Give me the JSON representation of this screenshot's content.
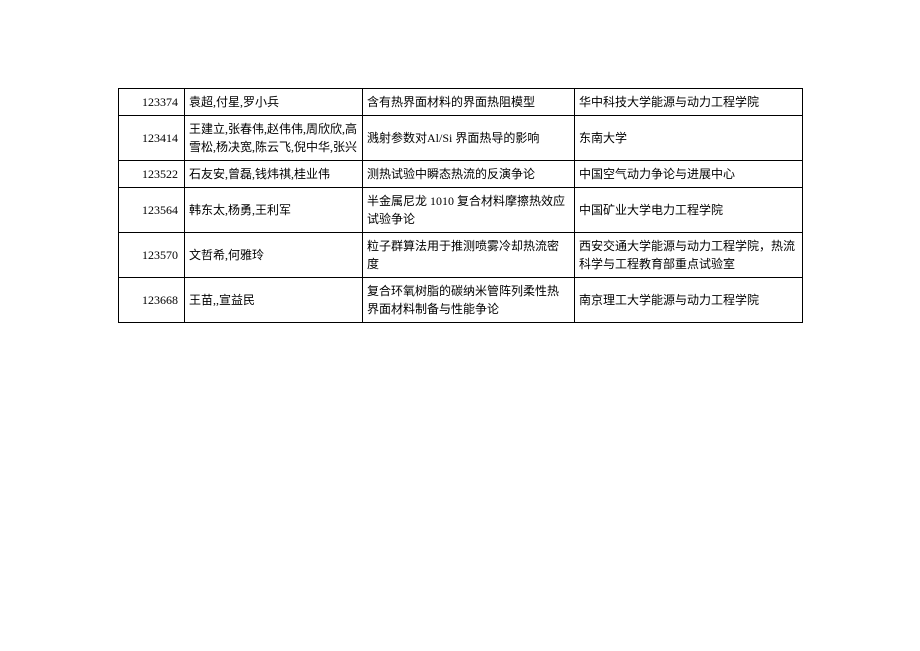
{
  "rows": [
    {
      "id": "123374",
      "authors": "袁超,付星,罗小兵",
      "title": "含有热界面材料的界面热阻模型",
      "affiliation": "华中科技大学能源与动力工程学院"
    },
    {
      "id": "123414",
      "authors": "王建立,张春伟,赵伟伟,周欣欣,高雪松,杨决宽,陈云飞,倪中华,张兴",
      "title": "溅射参数对Al/Si 界面热导的影响",
      "affiliation": "东南大学"
    },
    {
      "id": "123522",
      "authors": "石友安,曾磊,钱炜祺,桂业伟",
      "title": "测热试验中瞬态热流的反演争论",
      "affiliation": "中国空气动力争论与进展中心"
    },
    {
      "id": "123564",
      "authors": "韩东太,杨勇,王利军",
      "title": "半金属尼龙 1010 复合材料摩擦热效应试验争论",
      "affiliation": "中国矿业大学电力工程学院"
    },
    {
      "id": "123570",
      "authors": "文哲希,何雅玲",
      "title": "粒子群算法用于推测喷雾冷却热流密度",
      "affiliation": "西安交通大学能源与动力工程学院，热流科学与工程教育部重点试验室"
    },
    {
      "id": "123668",
      "authors": "王苗,,宣益民",
      "title": "复合环氧树脂的碳纳米管阵列柔性热界面材料制备与性能争论",
      "affiliation": "南京理工大学能源与动力工程学院"
    }
  ]
}
